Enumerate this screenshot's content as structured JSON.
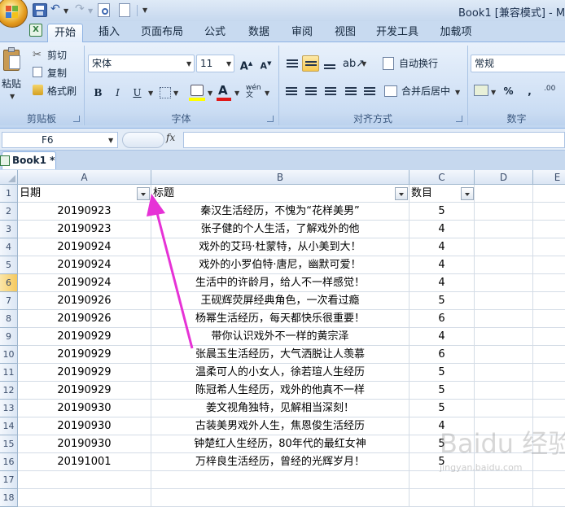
{
  "window": {
    "title": "Book1  [兼容模式] - M"
  },
  "ribbon_tabs": [
    "开始",
    "插入",
    "页面布局",
    "公式",
    "数据",
    "审阅",
    "视图",
    "开发工具",
    "加载项"
  ],
  "clipboard": {
    "paste": "粘贴",
    "cut": "剪切",
    "copy": "复制",
    "format_painter": "格式刷",
    "label": "剪贴板"
  },
  "font": {
    "name": "宋体",
    "size": "11",
    "bold": "B",
    "italic": "I",
    "underline": "U",
    "label": "字体"
  },
  "alignment": {
    "wrap": "自动换行",
    "merge": "合并后居中",
    "label": "对齐方式"
  },
  "number": {
    "format": "常规",
    "percent": "%",
    "comma": ",",
    "label": "数字"
  },
  "formula_bar": {
    "cell_ref": "F6",
    "fx": "fx",
    "content": ""
  },
  "workbook_tab": "Book1 *",
  "columns": [
    "A",
    "B",
    "C",
    "D",
    "E"
  ],
  "headers": {
    "date": "日期",
    "title": "标题",
    "count": "数目"
  },
  "rows": [
    {
      "date": "20190923",
      "title": "秦汉生活经历，不愧为“花样美男”",
      "count": "5"
    },
    {
      "date": "20190923",
      "title": "张子健的个人生活，了解戏外的他",
      "count": "4"
    },
    {
      "date": "20190924",
      "title": "戏外的艾玛·杜蒙特，从小美到大！",
      "count": "4"
    },
    {
      "date": "20190924",
      "title": "戏外的小罗伯特·唐尼，幽默可爱！",
      "count": "4"
    },
    {
      "date": "20190924",
      "title": "生活中的许龄月，给人不一样感觉！",
      "count": "4"
    },
    {
      "date": "20190926",
      "title": "王砚辉荧屏经典角色，一次看过瘾",
      "count": "5"
    },
    {
      "date": "20190926",
      "title": "杨幂生活经历，每天都快乐很重要！",
      "count": "6"
    },
    {
      "date": "20190929",
      "title": "带你认识戏外不一样的黄宗泽",
      "count": "4"
    },
    {
      "date": "20190929",
      "title": "张晨玉生活经历，大气洒脱让人羡慕",
      "count": "6"
    },
    {
      "date": "20190929",
      "title": "温柔可人的小女人，徐若瑄人生经历",
      "count": "5"
    },
    {
      "date": "20190929",
      "title": "陈冠希人生经历，戏外的他真不一样",
      "count": "5"
    },
    {
      "date": "20190930",
      "title": "姜文视角独特，见解相当深刻！",
      "count": "5"
    },
    {
      "date": "20190930",
      "title": "古装美男戏外人生，焦恩俊生活经历",
      "count": "4"
    },
    {
      "date": "20190930",
      "title": "钟楚红人生经历，80年代的最红女神",
      "count": "5"
    },
    {
      "date": "20191001",
      "title": "万梓良生活经历，曾经的光辉岁月！",
      "count": "5"
    }
  ],
  "row_numbers": [
    "1",
    "2",
    "3",
    "4",
    "5",
    "6",
    "7",
    "8",
    "9",
    "10",
    "11",
    "12",
    "13",
    "14",
    "15",
    "16",
    "17",
    "18"
  ],
  "watermark": {
    "text": "Baidu 经验",
    "sub": "jingyan.baidu.com"
  },
  "colors": {
    "arrow": "#e632d6",
    "selected_row": "#f5c95e"
  }
}
